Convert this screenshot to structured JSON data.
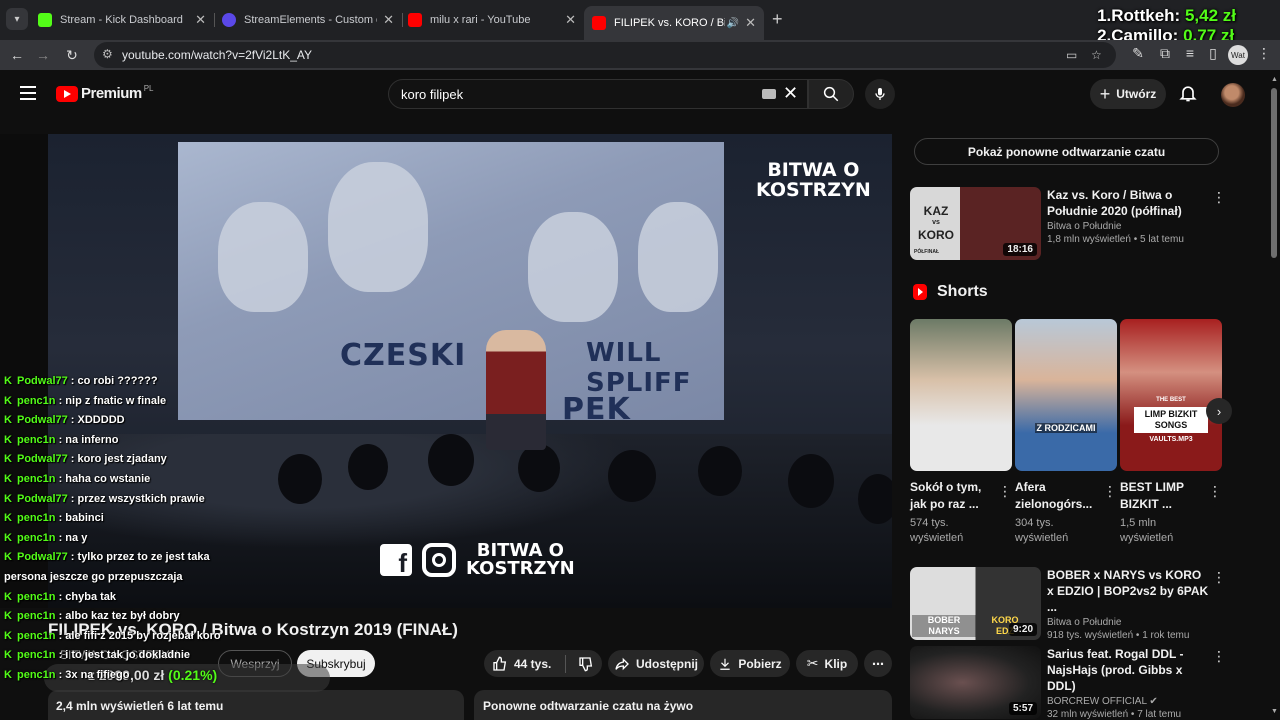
{
  "browser": {
    "tabs": [
      {
        "title": "Stream - Kick Dashboard",
        "favicon_color": "#53fc18"
      },
      {
        "title": "StreamElements - Custom comm",
        "favicon_color": "#5a48e8"
      },
      {
        "title": "milu x rari - YouTube",
        "favicon_color": "#ff0000"
      },
      {
        "title": "FILIPEK vs. KORO / Bitwa o K",
        "favicon_color": "#ff0000",
        "active": true
      }
    ],
    "url": "youtube.com/watch?v=2fVi2LtK_AY",
    "profile_label": "Wat"
  },
  "leaderboard": [
    {
      "rank": "1.",
      "name": "Rottkeh:",
      "amount": "5,42 zł"
    },
    {
      "rank": "2.",
      "name": "Camillo:",
      "amount": "0,77 zł"
    }
  ],
  "youtube": {
    "logo_text": "Premium",
    "logo_country": "PL",
    "search_query": "koro filipek",
    "create_label": "Utwórz"
  },
  "video": {
    "brand_top_1": "BITWA O",
    "brand_top_2": "KOSTRZYN",
    "screen_label_1": "CZESKI",
    "screen_label_2": "WILL SPLIFF",
    "screen_label_3": "PEK",
    "brand_bottom_1": "BITWA O",
    "brand_bottom_2": "KOSTRZYN",
    "fb_glyph": "f",
    "title": "FILIPEK vs. KORO / Bitwa o Kostrzyn 2019 (FINAŁ)",
    "channel": "BITWA O KOSTRZYN",
    "join_label": "Wesprzyj",
    "subscribe_label": "Subskrybuj",
    "likes": "44 tys.",
    "share_label": "Udostępnij",
    "download_label": "Pobierz",
    "clip_label": "Klip",
    "description_meta": "2,4 mln wyświetleń  6 lat temu",
    "replay_label": "Ponowne odtwarzanie czatu na żywo"
  },
  "chat": [
    {
      "user": "Podwal77",
      "msg": "co robi ??????"
    },
    {
      "user": "penc1n",
      "msg": "nip z fnatic w finale"
    },
    {
      "user": "Podwal77",
      "msg": "XDDDDD"
    },
    {
      "user": "penc1n",
      "msg": "na inferno"
    },
    {
      "user": "Podwal77",
      "msg": "koro jest zjadany"
    },
    {
      "user": "penc1n",
      "msg": "haha co wstanie"
    },
    {
      "user": "Podwal77",
      "msg": "przez wszystkich prawie"
    },
    {
      "user": "penc1n",
      "msg": "babinci"
    },
    {
      "user": "penc1n",
      "msg": "na y"
    },
    {
      "user": "Podwal77",
      "msg": "tylko przez to ze jest taka persona jeszcze go przepuszczaja"
    },
    {
      "user": "penc1n",
      "msg": "chyba tak"
    },
    {
      "user": "penc1n",
      "msg": "albo kaz tez był dobry"
    },
    {
      "user": "penc1n",
      "msg": "ale fifi z 2015 by rozjebał koro"
    },
    {
      "user": "penc1n",
      "msg": "i to jest tak jo dokladnie"
    },
    {
      "user": "penc1n",
      "msg": "3x na fifiego"
    }
  ],
  "goal": {
    "amount": "z 2999,00 zł",
    "percent": "(0.21%)"
  },
  "sidebar": {
    "chat_replay_btn": "Pokaż ponowne odtwarzanie czatu",
    "rec1": {
      "title": "Kaz vs. Koro  / Bitwa o Południe 2020 (półfinał)",
      "channel": "Bitwa o Południe",
      "meta": "1,8 mln wyświetleń • 5 lat temu",
      "duration": "18:16",
      "thumb_kaz": "KAZ",
      "thumb_vs": "vs",
      "thumb_koro": "KORO",
      "thumb_sub": "PÓŁFINAŁ"
    },
    "shorts_label": "Shorts",
    "shorts": [
      {
        "title": "Sokół o tym, jak po raz ...",
        "views": "574 tys. wyświetleń",
        "overlay": ""
      },
      {
        "title": "Afera zielonogórs...",
        "views": "304 tys. wyświetleń",
        "overlay": "Z RODZICAMI"
      },
      {
        "title": "BEST LIMP BIZKIT ...",
        "views": "1,5 mln wyświetleń",
        "overlay_top": "THE BEST",
        "overlay": "LIMP BIZKIT SONGS",
        "overlay_bottom": "VAULTS.MP3"
      }
    ],
    "rec2": {
      "title": "BOBER x NARYS vs KORO x EDZIO | BOP2vs2 by 6PAK ...",
      "channel": "Bitwa o Południe",
      "meta": "918 tys. wyświetleń • 1 rok temu",
      "duration": "9:20",
      "thumb_left": "BOBER NARYS",
      "thumb_right": "KORO EDZ"
    },
    "rec3": {
      "title": "Sarius feat. Rogal DDL - NajsHajs (prod. Gibbs x DDL)",
      "channel": "BORCREW OFFICIAL",
      "meta": "32 mln wyświetleń • 7 lat temu",
      "duration": "5:57"
    }
  }
}
